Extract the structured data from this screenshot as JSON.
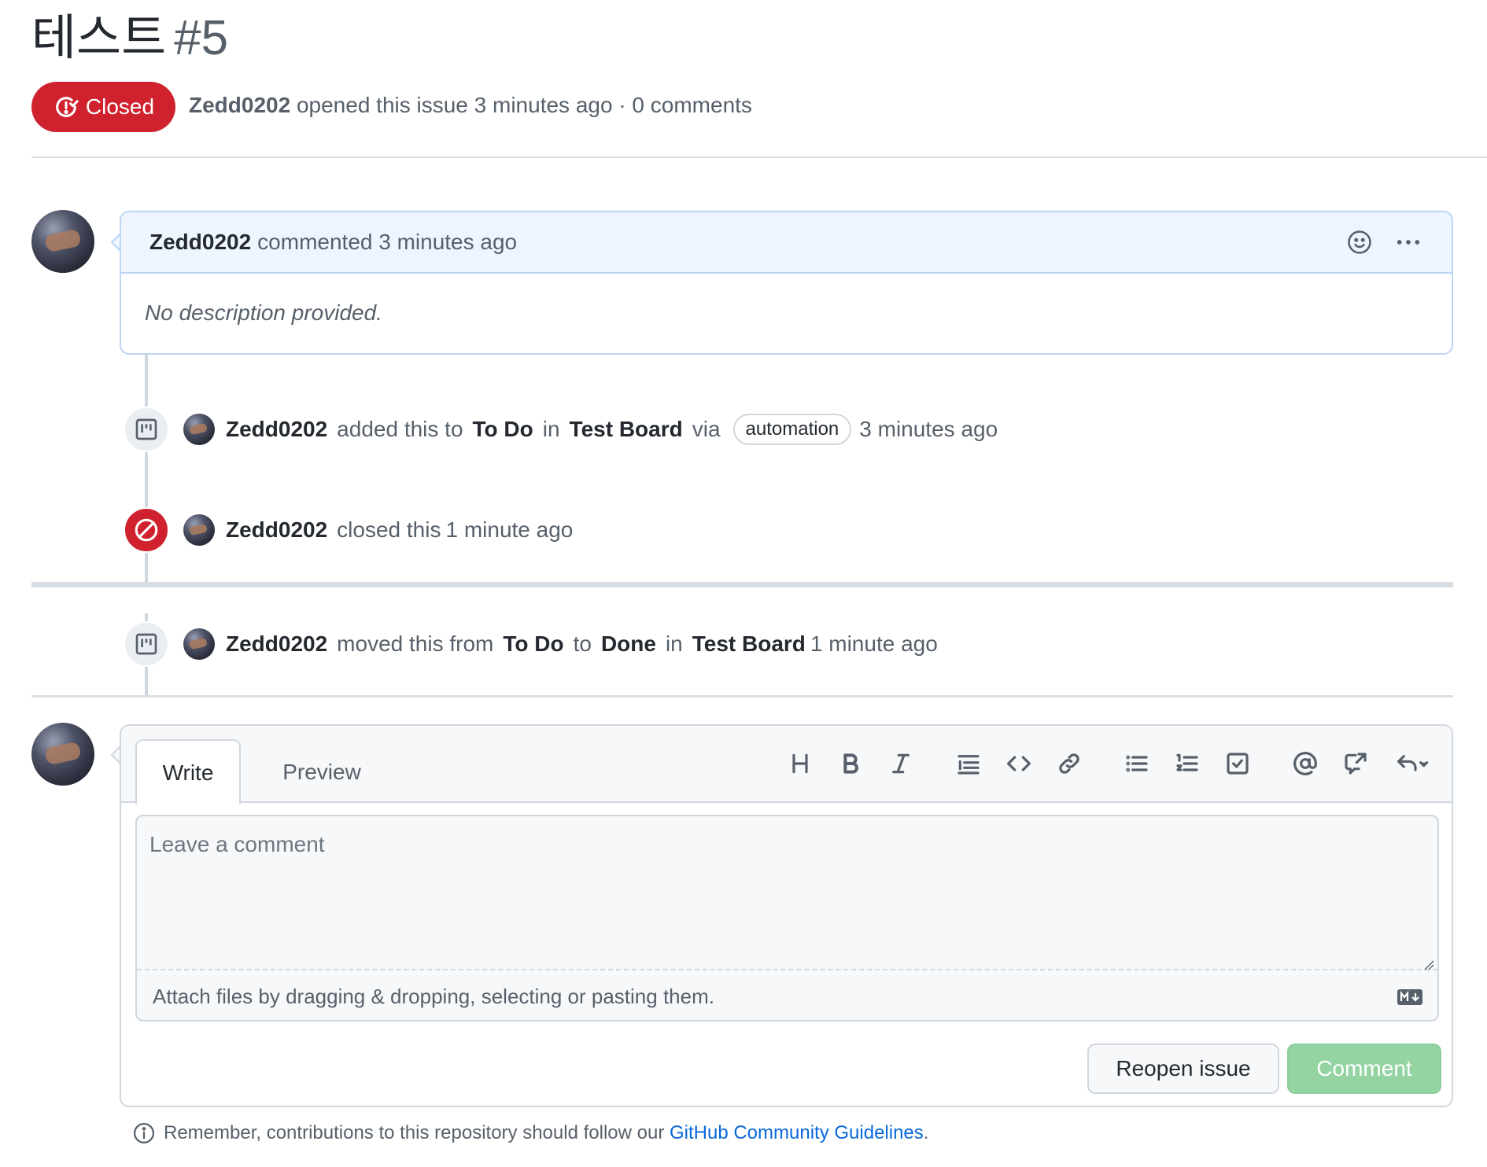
{
  "issue": {
    "title": "테스트",
    "number": "#5",
    "state_label": "Closed",
    "author": "Zedd0202",
    "opened_text": "opened this issue 3 minutes ago · 0 comments"
  },
  "first_comment": {
    "author": "Zedd0202",
    "action": "commented 3 minutes ago",
    "body": "No description provided.",
    "icons": [
      "smiley-icon",
      "kebab-menu-icon"
    ]
  },
  "events": [
    {
      "icon": "project-icon",
      "author": "Zedd0202",
      "parts": [
        "added this to",
        "To Do",
        "in",
        "Test Board",
        "via"
      ],
      "pill": "automation",
      "time": "3 minutes ago"
    },
    {
      "icon": "circle-slash-icon",
      "author": "Zedd0202",
      "action": "closed this",
      "time": "1 minute ago"
    },
    {
      "icon": "project-icon",
      "author": "Zedd0202",
      "parts": [
        "moved this from",
        "To Do",
        "to",
        "Done",
        "in",
        "Test Board"
      ],
      "time": "1 minute ago"
    }
  ],
  "editor": {
    "tabs": [
      "Write",
      "Preview"
    ],
    "active_tab": "Write",
    "toolbar": [
      "heading-icon",
      "bold-icon",
      "italic-icon",
      "quote-icon",
      "code-icon",
      "link-icon",
      "unordered-list-icon",
      "ordered-list-icon",
      "task-list-icon",
      "mention-icon",
      "cross-reference-icon",
      "reply-icon"
    ],
    "placeholder": "Leave a comment",
    "attach_text": "Attach files by dragging & dropping, selecting or pasting them.",
    "reopen_label": "Reopen issue",
    "comment_label": "Comment"
  },
  "footer": {
    "prefix": "Remember, contributions to this repository should follow our",
    "link": "GitHub Community Guidelines",
    "suffix": "."
  },
  "colors": {
    "closed_red": "#cf222e",
    "link_blue": "#0969da",
    "comment_disabled_green": "#94d3a2"
  }
}
